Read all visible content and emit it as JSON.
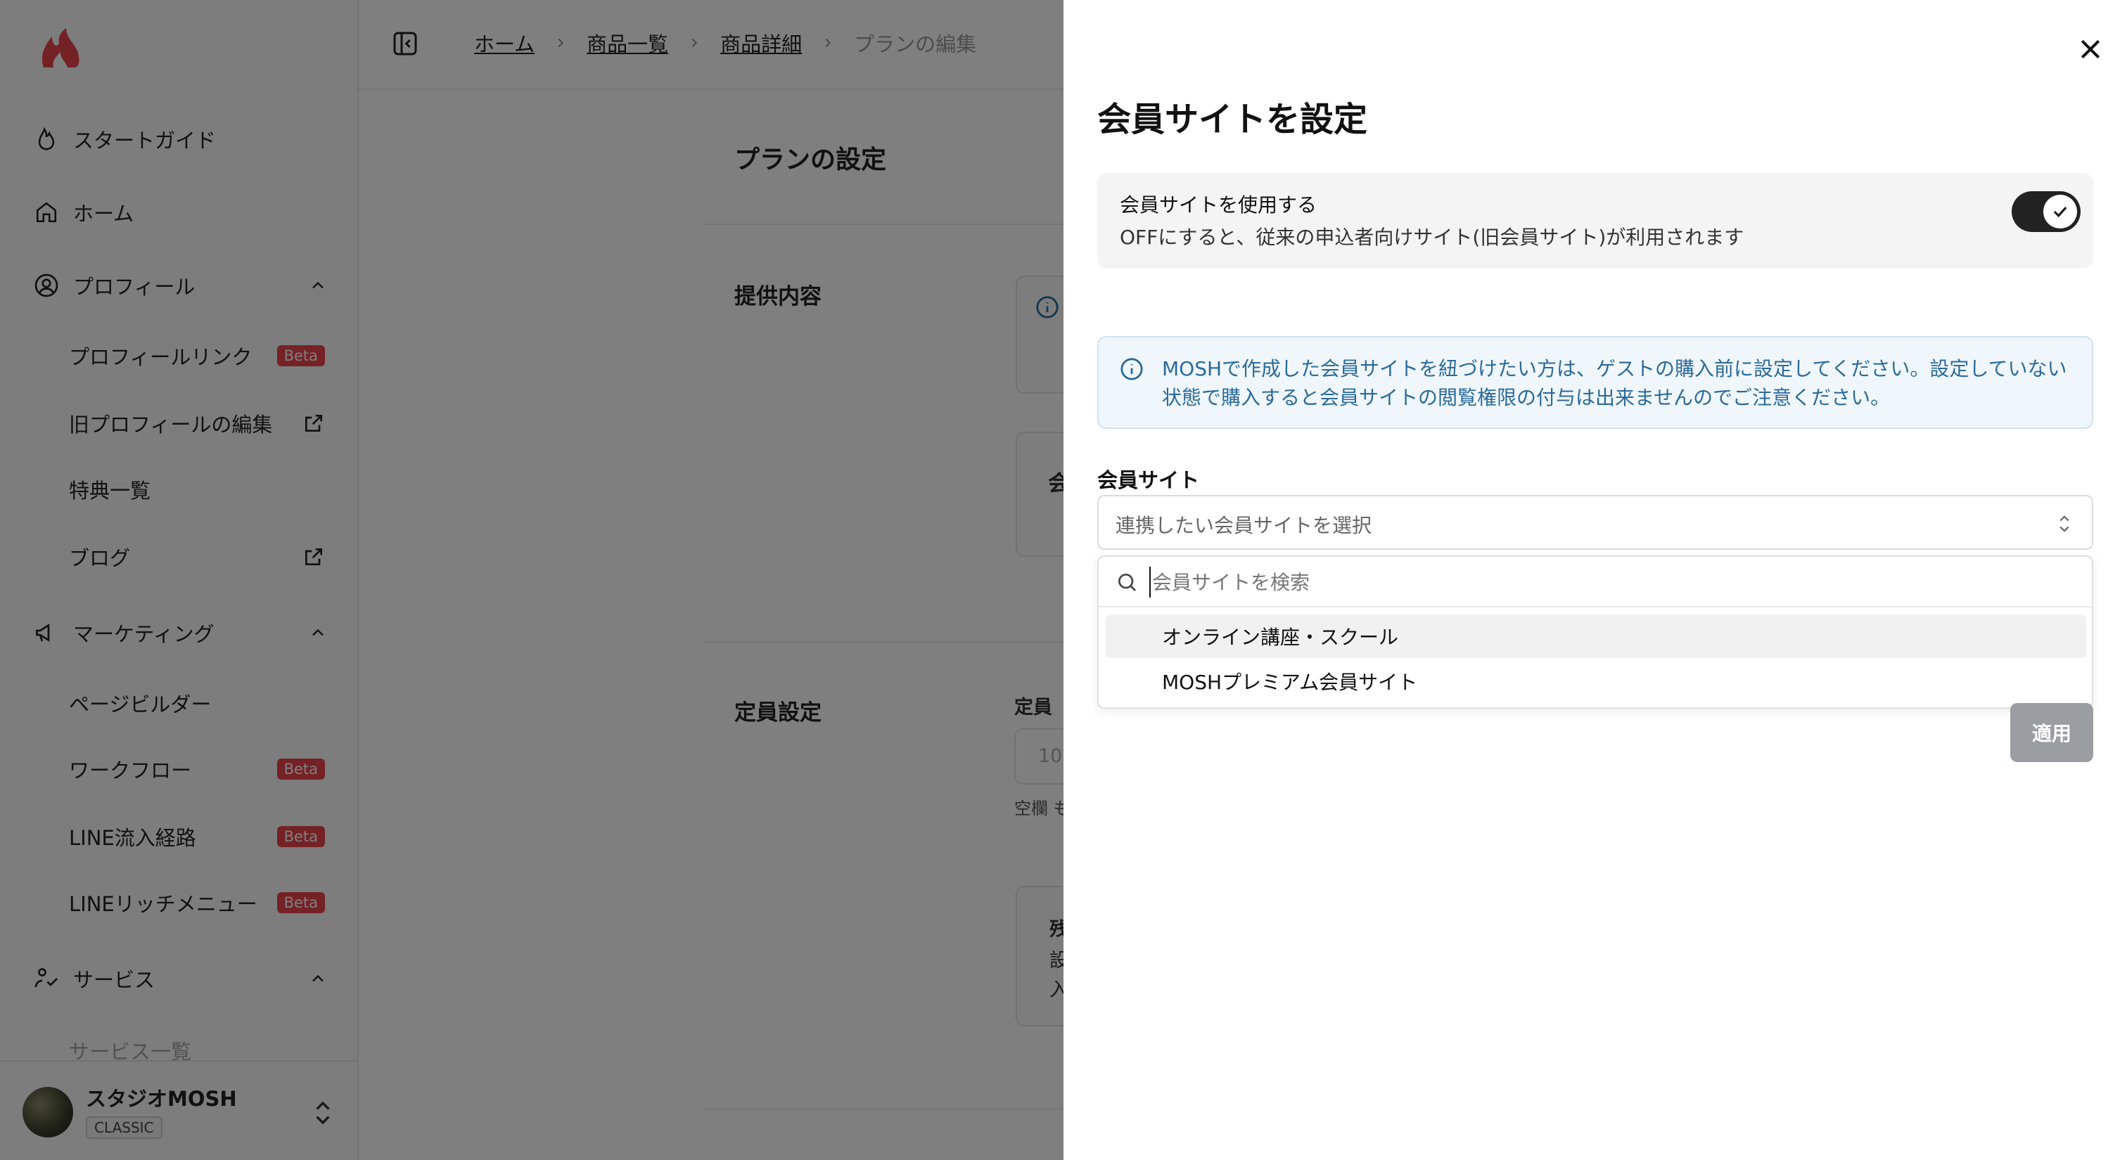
{
  "sidebar": {
    "nav": [
      {
        "label": "スタートガイド",
        "icon": "flame-icon"
      },
      {
        "label": "ホーム",
        "icon": "home-icon"
      },
      {
        "label": "プロフィール",
        "icon": "user-circle-icon"
      },
      {
        "label": "マーケティング",
        "icon": "megaphone-icon"
      },
      {
        "label": "サービス",
        "icon": "service-icon"
      }
    ],
    "profile_items": [
      {
        "label": "プロフィールリンク",
        "badge": "Beta"
      },
      {
        "label": "旧プロフィールの編集",
        "icon": "external-link-icon"
      },
      {
        "label": "特典一覧"
      },
      {
        "label": "ブログ",
        "icon": "external-link-icon"
      }
    ],
    "marketing_items": [
      {
        "label": "ページビルダー"
      },
      {
        "label": "ワークフロー",
        "badge": "Beta"
      },
      {
        "label": "LINE流入経路",
        "badge": "Beta"
      },
      {
        "label": "LINEリッチメニュー",
        "badge": "Beta"
      }
    ],
    "service_items": [
      {
        "label": "サービス一覧"
      }
    ],
    "user": {
      "name": "スタジオMOSH",
      "plan": "CLASSIC"
    }
  },
  "breadcrumb": [
    "ホーム",
    "商品一覧",
    "商品詳細",
    "プランの編集"
  ],
  "main": {
    "title": "プランの設定",
    "sections": [
      "提供内容",
      "定員設定"
    ],
    "fragments": {
      "kai": "会",
      "teiin": "定員",
      "placeholder_10": "10",
      "kuuran": "空欄 も",
      "zan": "残",
      "setsu": "設",
      "iri": "入"
    }
  },
  "sheet": {
    "title": "会員サイトを設定",
    "toggle": {
      "title": "会員サイトを使用する",
      "description": "OFFにすると、従来の申込者向けサイト(旧会員サイト)が利用されます",
      "on": true
    },
    "info": "MOSHで作成した会員サイトを紐づけたい方は、ゲストの購入前に設定してください。設定していない状態で購入すると会員サイトの閲覧権限の付与は出来ませんのでご注意ください。",
    "field_label": "会員サイト",
    "select_placeholder": "連携したい会員サイトを選択",
    "search_placeholder": "会員サイトを検索",
    "options": [
      "オンライン講座・スクール",
      "MOSHプレミアム会員サイト"
    ],
    "apply_label": "適用"
  },
  "colors": {
    "overlay": "#000000",
    "info_text": "#2b6a9a",
    "badge": "#e8454a",
    "apply_disabled": "#9a9ea3"
  }
}
